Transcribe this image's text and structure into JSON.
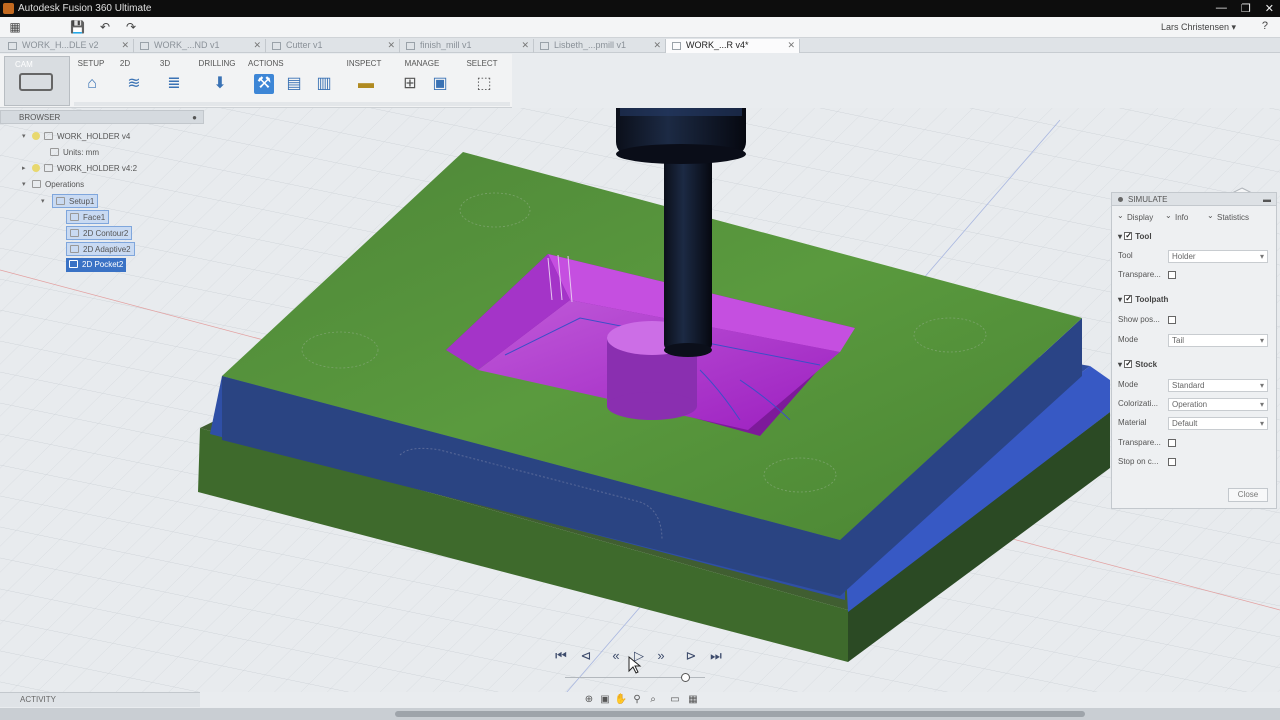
{
  "window": {
    "title": "Autodesk Fusion 360 Ultimate",
    "controls": [
      "—",
      "❐",
      "✕"
    ]
  },
  "qat": {
    "user": "Lars Christensen ▾",
    "help": "?",
    "icons": [
      "grid-icon",
      "save-icon",
      "undo-icon",
      "redo-icon"
    ]
  },
  "tabs": [
    {
      "label": "WORK_H...DLE v2"
    },
    {
      "label": "WORK_...ND v1"
    },
    {
      "label": "Cutter v1"
    },
    {
      "label": "finish_mill v1"
    },
    {
      "label": "Lisbeth_...pmill v1"
    },
    {
      "label": "WORK_...R v4*",
      "active": true
    }
  ],
  "ribbon": {
    "workspace": "CAM",
    "groups": [
      {
        "label": "SETUP"
      },
      {
        "label": "2D"
      },
      {
        "label": "3D"
      },
      {
        "label": "DRILLING"
      },
      {
        "label": "ACTIONS"
      },
      {
        "label": "INSPECT"
      },
      {
        "label": "MANAGE"
      },
      {
        "label": "SELECT"
      }
    ]
  },
  "browser": {
    "header": "BROWSER",
    "nodes": [
      {
        "label": "WORK_HOLDER v4"
      },
      {
        "label": "Units: mm"
      },
      {
        "label": "WORK_HOLDER v4:2"
      },
      {
        "label": "Operations"
      },
      {
        "label": "Setup1"
      },
      {
        "label": "Face1"
      },
      {
        "label": "2D Contour2"
      },
      {
        "label": "2D Adaptive2"
      },
      {
        "label": "2D Pocket2"
      }
    ]
  },
  "simulate": {
    "header": "SIMULATE",
    "tabs": [
      "Display",
      "Info",
      "Statistics"
    ],
    "tool_section": "Tool",
    "tool_label": "Tool",
    "tool_value": "Holder",
    "tool_transparent": "Transpare...",
    "toolpath_section": "Toolpath",
    "show_pos": "Show pos...",
    "mode_label": "Mode",
    "toolpath_mode": "Tail",
    "stock_section": "Stock",
    "stock_mode": "Standard",
    "colorization_label": "Colorizati...",
    "colorization_value": "Operation",
    "material_label": "Material",
    "material_value": "Default",
    "stock_transparent": "Transpare...",
    "stop_on_collision": "Stop on c...",
    "close": "Close"
  },
  "activity": "ACTIVITY",
  "playback": {
    "position": 0.86,
    "icons": [
      "skip-start-icon",
      "prev-step-icon",
      "step-back-icon",
      "play-icon",
      "step-forward-icon",
      "next-step-icon",
      "skip-end-icon"
    ]
  },
  "colors": {
    "accent": "#3a72c5",
    "stock_green": "#4f8a36",
    "pocket_magenta": "#b23ad1",
    "base_blue": "#2f4c9c"
  }
}
